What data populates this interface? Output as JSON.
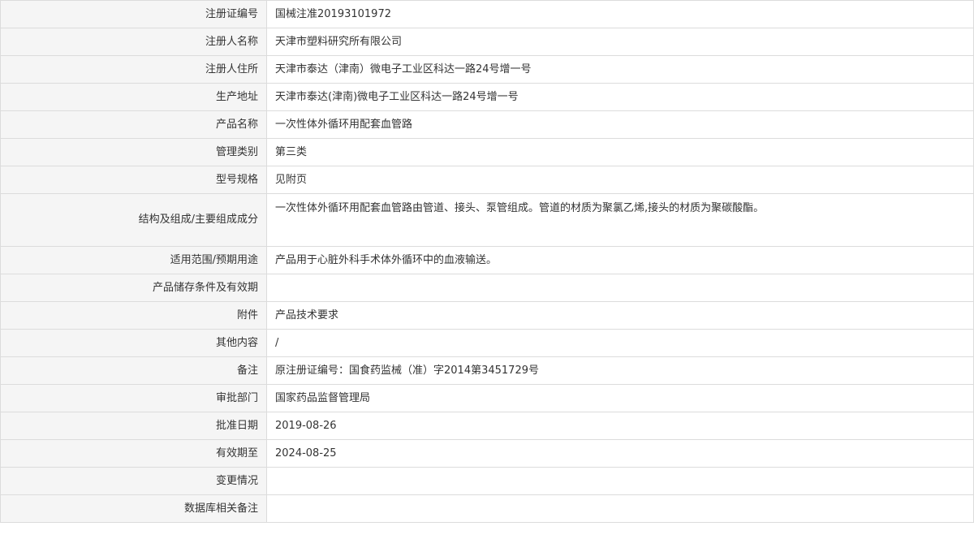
{
  "rows": [
    {
      "label": "注册证编号",
      "value": "国械注准20193101972"
    },
    {
      "label": "注册人名称",
      "value": "天津市塑料研究所有限公司"
    },
    {
      "label": "注册人住所",
      "value": "天津市泰达（津南）微电子工业区科达一路24号增一号"
    },
    {
      "label": "生产地址",
      "value": "天津市泰达(津南)微电子工业区科达一路24号增一号"
    },
    {
      "label": "产品名称",
      "value": "一次性体外循环用配套血管路"
    },
    {
      "label": "管理类别",
      "value": "第三类"
    },
    {
      "label": "型号规格",
      "value": "见附页"
    },
    {
      "label": "结构及组成/主要组成成分",
      "value": "一次性体外循环用配套血管路由管道、接头、泵管组成。管道的材质为聚氯乙烯,接头的材质为聚碳酸酯。"
    },
    {
      "label": "适用范围/预期用途",
      "value": "产品用于心脏外科手术体外循环中的血液输送。"
    },
    {
      "label": "产品储存条件及有效期",
      "value": ""
    },
    {
      "label": "附件",
      "value": "产品技术要求"
    },
    {
      "label": "其他内容",
      "value": "/"
    },
    {
      "label": "备注",
      "value": "原注册证编号：国食药监械（准）字2014第3451729号"
    },
    {
      "label": "审批部门",
      "value": "国家药品监督管理局"
    },
    {
      "label": "批准日期",
      "value": "2019-08-26"
    },
    {
      "label": "有效期至",
      "value": "2024-08-25"
    },
    {
      "label": "变更情况",
      "value": ""
    },
    {
      "label": "数据库相关备注",
      "value": ""
    }
  ]
}
